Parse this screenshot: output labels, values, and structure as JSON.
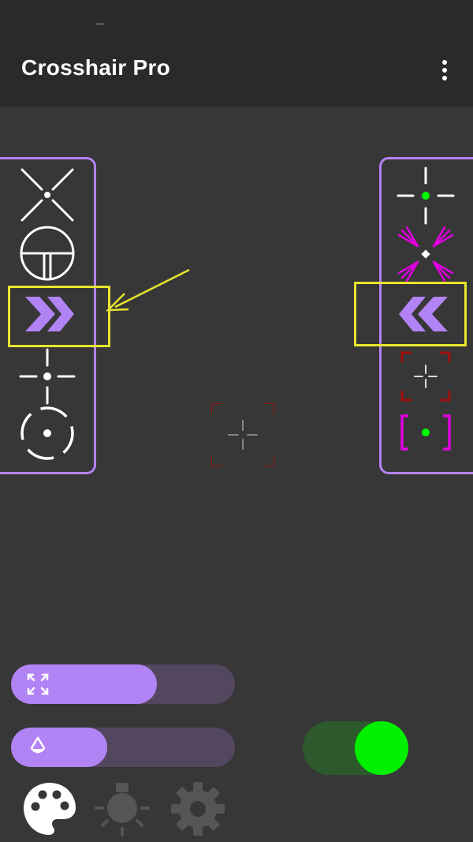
{
  "app": {
    "title": "Crosshair Pro",
    "menu_icon": "more-vert-icon"
  },
  "left_panel": {
    "items": [
      {
        "icon": "x-cross-dot-crosshair-icon",
        "color": "#ffffff"
      },
      {
        "icon": "scope-crosshair-icon",
        "color": "#ffffff"
      },
      {
        "icon": "chevron-right-double-icon",
        "color": "#b283f5"
      },
      {
        "icon": "dash-cross-dot-crosshair-icon",
        "color": "#ffffff"
      },
      {
        "icon": "dashed-circle-dot-crosshair-icon",
        "color": "#ffffff"
      }
    ]
  },
  "right_panel": {
    "items": [
      {
        "icon": "green-dot-cross-crosshair-icon",
        "color": "#00ff00"
      },
      {
        "icon": "magenta-x-crosshair-icon",
        "color": "#e000e0"
      },
      {
        "icon": "chevron-left-double-icon",
        "color": "#b283f5"
      },
      {
        "icon": "red-bracket-cross-crosshair-icon",
        "color": "#a01010"
      },
      {
        "icon": "magenta-bracket-dot-crosshair-icon",
        "color": "#e000e0"
      }
    ]
  },
  "annotations": {
    "highlight_color": "#e6e62e",
    "arrow_color": "#e6e62e"
  },
  "preview": {
    "icon": "red-bracket-cross-crosshair-icon"
  },
  "controls": {
    "size_slider": {
      "icon": "expand-icon",
      "value": 0.65
    },
    "opacity_slider": {
      "icon": "opacity-drop-icon",
      "value": 0.43
    },
    "enable_toggle": {
      "on": true,
      "color": "#00f000"
    }
  },
  "bottom_tabs": [
    {
      "icon": "palette-icon",
      "active": true
    },
    {
      "icon": "brightness-icon",
      "active": false
    },
    {
      "icon": "settings-gear-icon",
      "active": false
    }
  ],
  "colors": {
    "accent": "#b283f5",
    "background": "#373737",
    "appbar": "#2a2a2a"
  }
}
